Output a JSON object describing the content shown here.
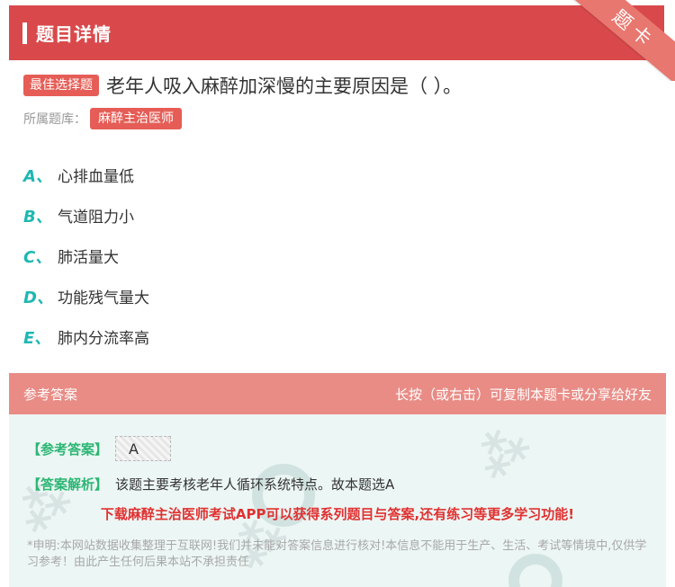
{
  "header": {
    "title": "题目详情",
    "corner_label": "题卡"
  },
  "question": {
    "type_badge": "最佳选择题",
    "text": "老年人吸入麻醉加深慢的主要原因是（ ）。"
  },
  "bank": {
    "label": "所属题库：",
    "name": "麻醉主治医师"
  },
  "options": [
    {
      "letter": "A、",
      "text": "心排血量低"
    },
    {
      "letter": "B、",
      "text": "气道阻力小"
    },
    {
      "letter": "C、",
      "text": "肺活量大"
    },
    {
      "letter": "D、",
      "text": "功能残气量大"
    },
    {
      "letter": "E、",
      "text": "肺内分流率高"
    }
  ],
  "answer_section": {
    "title": "参考答案",
    "hint": "长按（或右击）可复制本题卡或分享给好友",
    "reference_label": "【参考答案】",
    "reference_value": "A",
    "analysis_label": "【答案解析】",
    "analysis_text": "该题主要考核老年人循环系统特点。故本题选A",
    "promo": "下载麻醉主治医师考试APP可以获得系列题目与答案,还有练习等更多学习功能!",
    "disclaimer": "*申明:本网站数据收集整理于互联网!我们并未能对答案信息进行核对!本信息不能用于生产、生活、考试等情境中,仅供学习参考！由此产生任何后果本站不承担责任"
  },
  "colors": {
    "header_bg": "#d9494b",
    "badge_bg": "#e55d56",
    "option_letter": "#1fb7b2",
    "answer_header_bg": "#e98c86",
    "answer_body_bg": "#ecf6f4",
    "green_label": "#2bb673",
    "promo_red": "#e03131"
  }
}
